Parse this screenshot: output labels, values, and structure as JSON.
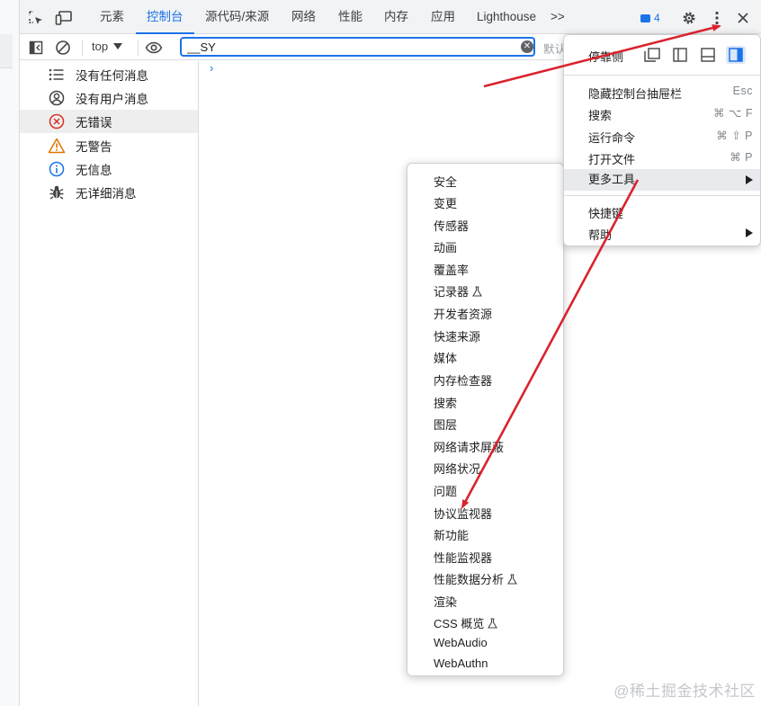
{
  "tabs": [
    {
      "label": "元素"
    },
    {
      "label": "控制台",
      "active": true
    },
    {
      "label": "源代码/来源"
    },
    {
      "label": "网络"
    },
    {
      "label": "性能"
    },
    {
      "label": "内存"
    },
    {
      "label": "应用"
    },
    {
      "label": "Lighthouse"
    }
  ],
  "overflow_tabs": ">>",
  "issues_count": "4",
  "filterbar": {
    "context": "top",
    "filter_value": "__SY",
    "default_levels_partial": "默认"
  },
  "sidebar": {
    "items": [
      {
        "label": "没有任何消息",
        "icon": "list-icon"
      },
      {
        "label": "没有用户消息",
        "icon": "user-circle-icon"
      },
      {
        "label": "无错误",
        "icon": "error-icon"
      },
      {
        "label": "无警告",
        "icon": "warning-icon"
      },
      {
        "label": "无信息",
        "icon": "info-icon"
      },
      {
        "label": "无详细消息",
        "icon": "bug-icon"
      }
    ]
  },
  "console": {
    "prompt": "›"
  },
  "main_menu": {
    "dock_label": "停靠侧",
    "items": [
      {
        "label": "隐藏控制台抽屉栏",
        "shortcut": "Esc"
      },
      {
        "label": "搜索",
        "shortcut": "⌘ ⌥ F"
      },
      {
        "label": "运行命令",
        "shortcut": "⌘ ⇧ P"
      },
      {
        "label": "打开文件",
        "shortcut": "⌘ P"
      },
      {
        "label": "更多工具",
        "submenu": true
      },
      {
        "label": "快捷键"
      },
      {
        "label": "帮助",
        "submenu": true
      }
    ]
  },
  "more_tools": [
    {
      "label": "安全"
    },
    {
      "label": "变更"
    },
    {
      "label": "传感器"
    },
    {
      "label": "动画"
    },
    {
      "label": "覆盖率"
    },
    {
      "label": "记录器",
      "experimental": true
    },
    {
      "label": "开发者资源"
    },
    {
      "label": "快速来源"
    },
    {
      "label": "媒体"
    },
    {
      "label": "内存检查器"
    },
    {
      "label": "搜索"
    },
    {
      "label": "图层"
    },
    {
      "label": "网络请求屏蔽"
    },
    {
      "label": "网络状况"
    },
    {
      "label": "问题"
    },
    {
      "label": "协议监视器"
    },
    {
      "label": "新功能"
    },
    {
      "label": "性能监视器"
    },
    {
      "label": "性能数据分析",
      "experimental": true
    },
    {
      "label": "渲染"
    },
    {
      "label": "CSS 概览",
      "experimental": true
    },
    {
      "label": "WebAudio"
    },
    {
      "label": "WebAuthn"
    }
  ],
  "watermark": "@稀土掘金技术社区",
  "colors": {
    "accent": "#1a73e8",
    "annotation_arrow": "#d9232e",
    "error": "#d93025",
    "warning": "#e37400"
  }
}
